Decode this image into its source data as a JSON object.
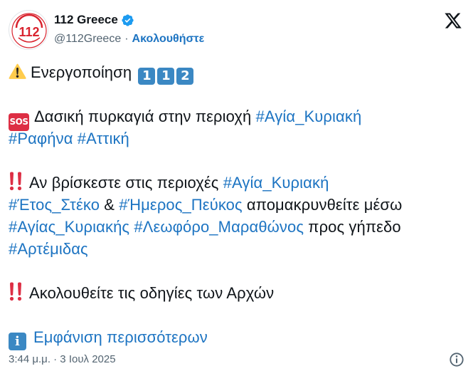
{
  "account": {
    "display_name": "112 Greece",
    "handle": "@112Greece",
    "separator": "·",
    "follow_label": "Ακολουθήστε",
    "avatar_text": "112"
  },
  "tweet": {
    "line1": "Ενεργοποίηση",
    "keycaps": [
      "1",
      "1",
      "2"
    ],
    "sos_label": "SOS",
    "line2_text": "Δασική πυρκαγιά στην περιοχή ",
    "tag_agia_kyriaki": "#Αγία_Κυριακή",
    "tag_rafina": "#Ραφήνα",
    "tag_attiki": "#Αττική",
    "line3_text": "Αν βρίσκεστε στις περιοχές ",
    "tag_etos_steko": "#Έτος_Στέκο",
    "amp": " & ",
    "tag_imeros_pefkos": "#Ήμερος_Πεύκος",
    "line3b_text": " απομακρυνθείτε μέσω",
    "tag_agias_kyriakis": "#Αγίας_Κυριακής",
    "tag_leoforo": "#Λεωφόρο_Μαραθώνος",
    "line3c_text": " προς γήπεδο",
    "tag_artemidas": "#Αρτέμιδας",
    "line4_text": "Ακολουθείτε τις οδηγίες των Αρχών",
    "info_glyph": "i",
    "show_more": "Εμφάνιση περισσότερων"
  },
  "footer": {
    "timestamp": "3:44 μ.μ. · 3 Ιουλ 2025"
  },
  "colors": {
    "link": "#1d74c2",
    "text": "#0f1419",
    "muted": "#536471",
    "verified": "#1d9bf0",
    "keycap": "#3b88c3",
    "sos": "#dd2e44"
  },
  "icons": [
    "verified-badge-icon",
    "x-logo-icon",
    "warning-icon",
    "sos-icon",
    "double-exclamation-icon",
    "information-icon",
    "info-circle-icon"
  ]
}
